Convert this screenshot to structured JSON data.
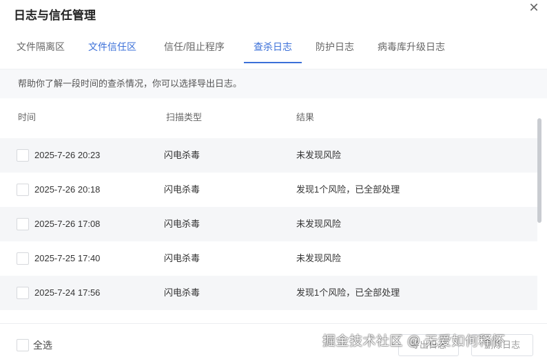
{
  "dialog": {
    "title": "日志与信任管理",
    "close_glyph": "✕"
  },
  "tabs": [
    {
      "label": "文件隔离区"
    },
    {
      "label": "文件信任区"
    },
    {
      "label": "信任/阻止程序"
    },
    {
      "label": "查杀日志"
    },
    {
      "label": "防护日志"
    },
    {
      "label": "病毒库升级日志"
    }
  ],
  "active_tab": "查杀日志",
  "description": "帮助你了解一段时间的查杀情况，你可以选择导出日志。",
  "table": {
    "headers": {
      "time": "时间",
      "scan_type": "扫描类型",
      "result": "结果"
    },
    "rows": [
      {
        "time": "2025-7-26 20:23",
        "scan_type": "闪电杀毒",
        "result": "未发现风险"
      },
      {
        "time": "2025-7-26 20:18",
        "scan_type": "闪电杀毒",
        "result": "发现1个风险，已全部处理"
      },
      {
        "time": "2025-7-26 17:08",
        "scan_type": "闪电杀毒",
        "result": "未发现风险"
      },
      {
        "time": "2025-7-25 17:40",
        "scan_type": "闪电杀毒",
        "result": "未发现风险"
      },
      {
        "time": "2025-7-24 17:56",
        "scan_type": "闪电杀毒",
        "result": "发现1个风险，已全部处理"
      }
    ]
  },
  "footer": {
    "select_all_label": "全选",
    "export_button": "导出日志",
    "delete_button": "删除日志"
  },
  "watermark": "掘金技术社区 @ 无爱如何释怀",
  "colors": {
    "accent": "#3a6fd8",
    "row_alt": "#f5f6f8"
  }
}
